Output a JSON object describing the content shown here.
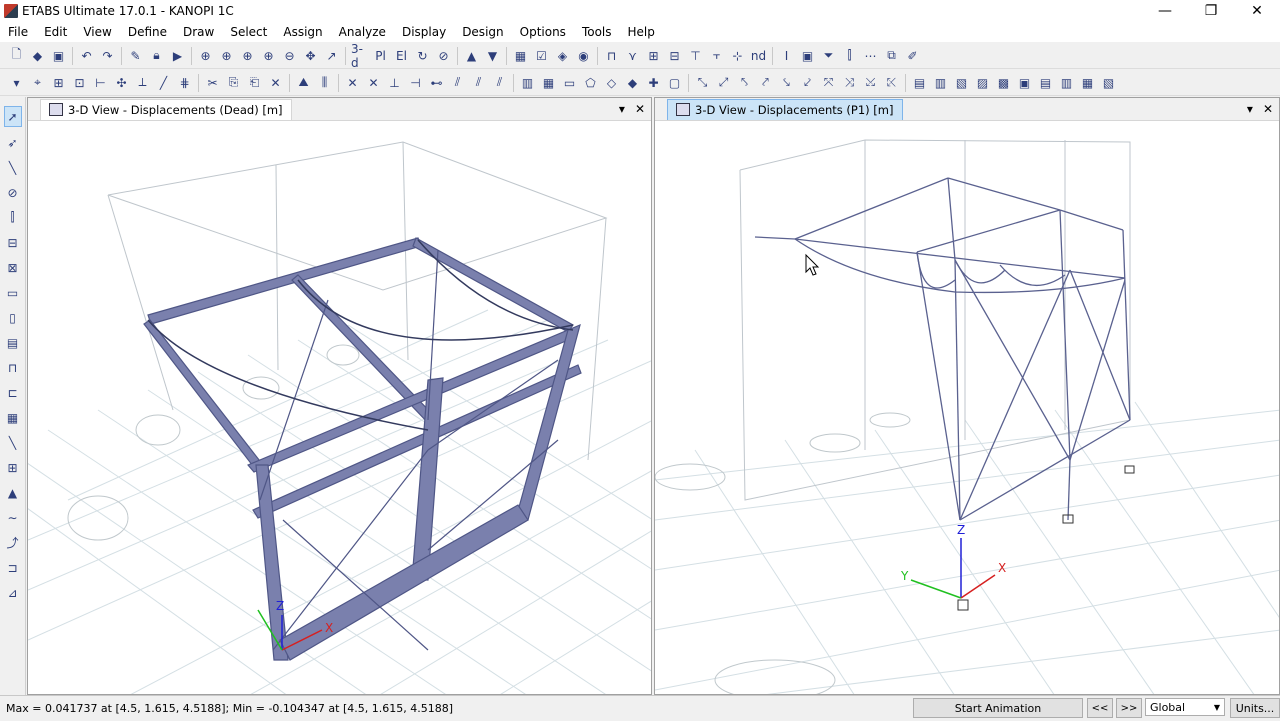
{
  "window": {
    "title": "ETABS Ultimate 17.0.1 - KANOPI 1C",
    "minimize": "—",
    "restore": "❐",
    "close": "✕"
  },
  "menu": [
    "File",
    "Edit",
    "View",
    "Define",
    "Draw",
    "Select",
    "Assign",
    "Analyze",
    "Display",
    "Design",
    "Options",
    "Tools",
    "Help"
  ],
  "toolbar": {
    "view_3d_label": "3-d",
    "plan_label": "Pl",
    "elev_label": "El",
    "nd_label": "nd"
  },
  "left_view": {
    "title": "3-D View  - Displacements (Dead)  [m]",
    "close": "✕",
    "menu_arrow": "▾",
    "axis_x": "X",
    "axis_z": "Z"
  },
  "right_view": {
    "title": "3-D View  - Displacements (P1)  [m]",
    "close": "✕",
    "menu_arrow": "▾",
    "axis_x": "X",
    "axis_y": "Y",
    "axis_z": "Z"
  },
  "status": {
    "text": "Max = 0.041737 at [4.5, 1.615, 4.5188];  Min = -0.104347 at [4.5, 1.615, 4.5188]",
    "start_animation": "Start Animation",
    "prev": "<<",
    "next": ">>",
    "coord_system": "Global",
    "units": "Units..."
  },
  "colors": {
    "frame": "#5a618f",
    "frame_fill": "#7a80ad",
    "grid": "#c9d6dc",
    "selected_tab": "#cce4f7"
  }
}
